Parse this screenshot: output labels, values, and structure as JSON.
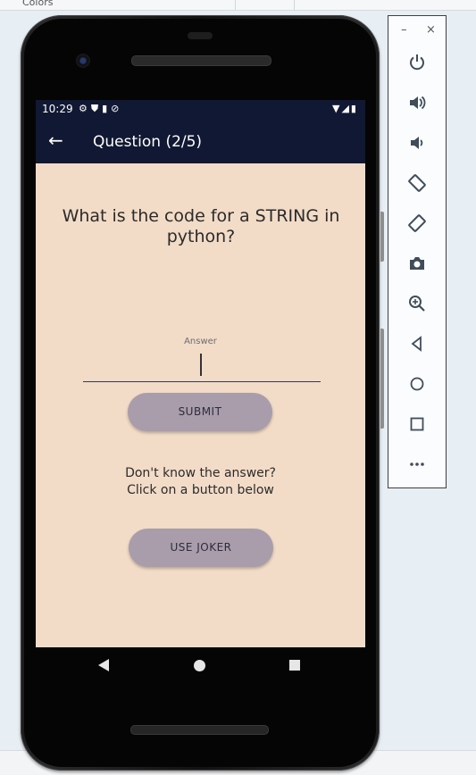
{
  "ide": {
    "top_label": "Colors"
  },
  "status_bar": {
    "time": "10:29",
    "left_icons": "⚙⛊▮⊘",
    "right_icons": "▼◢▮"
  },
  "app_bar": {
    "back_icon": "←",
    "title": "Question (2/5)"
  },
  "question": {
    "text": "What is the code for a STRING in python?"
  },
  "answer": {
    "label": "Answer",
    "value": ""
  },
  "buttons": {
    "submit": "SUBMIT",
    "joker": "USE JOKER"
  },
  "hint": {
    "line1": "Don't know the answer?",
    "line2": "Click on a button below"
  },
  "emulator_toolbar": {
    "minimize": "–",
    "close": "×",
    "tools": [
      "power-icon",
      "volume-up-icon",
      "volume-down-icon",
      "rotate-left-icon",
      "rotate-right-icon",
      "camera-icon",
      "zoom-icon",
      "back-icon",
      "home-icon",
      "overview-icon",
      "more-icon"
    ],
    "glyphs": {
      "power": "⏻",
      "vol_up": "🔊",
      "vol_down": "🔉",
      "rot_l": "◇",
      "rot_r": "◇",
      "camera": "📷",
      "zoom": "⊕",
      "back": "◁",
      "home": "○",
      "overview": "□",
      "more": "•••"
    }
  },
  "colors": {
    "app_bar": "#111834",
    "screen_bg": "#f2dcc7",
    "button": "#aa9dab"
  }
}
